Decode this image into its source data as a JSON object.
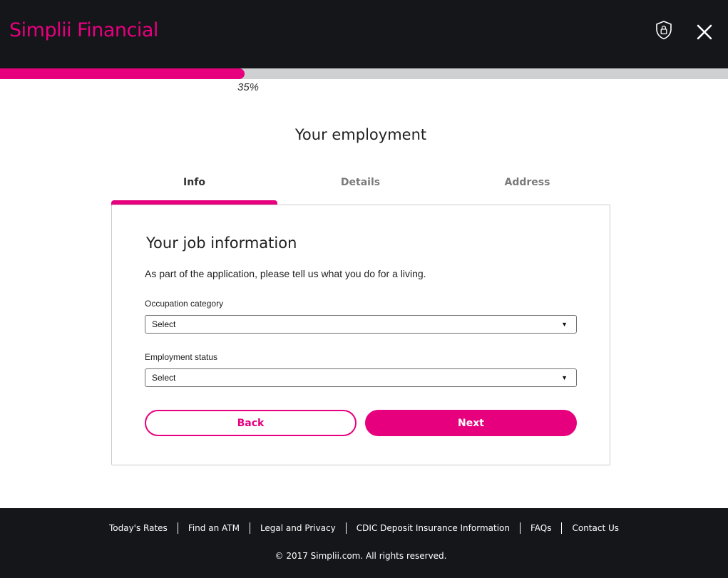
{
  "header": {
    "logo_text": "Simplii Financial",
    "icons": {
      "security": "shield-lock-icon",
      "close": "close-icon"
    }
  },
  "progress": {
    "percent": 35,
    "label": "35%"
  },
  "page": {
    "title": "Your employment"
  },
  "tabs": [
    {
      "label": "Info",
      "active": true
    },
    {
      "label": "Details",
      "active": false
    },
    {
      "label": "Address",
      "active": false
    }
  ],
  "card": {
    "title": "Your job information",
    "description": "As part of the application, please tell us what you do for a living.",
    "fields": [
      {
        "label": "Occupation category",
        "value": "Select"
      },
      {
        "label": "Employment status",
        "value": "Select"
      }
    ],
    "buttons": {
      "back": "Back",
      "next": "Next"
    }
  },
  "footer": {
    "links": [
      "Today's Rates",
      "Find an ATM",
      "Legal and Privacy",
      "CDIC Deposit Insurance Information",
      "FAQs",
      "Contact Us"
    ],
    "copyright": "© 2017 Simplii.com. All rights reserved."
  },
  "colors": {
    "brand": "#e6007e",
    "header_bg": "#15161a",
    "progress_track": "#cfd0d2"
  }
}
